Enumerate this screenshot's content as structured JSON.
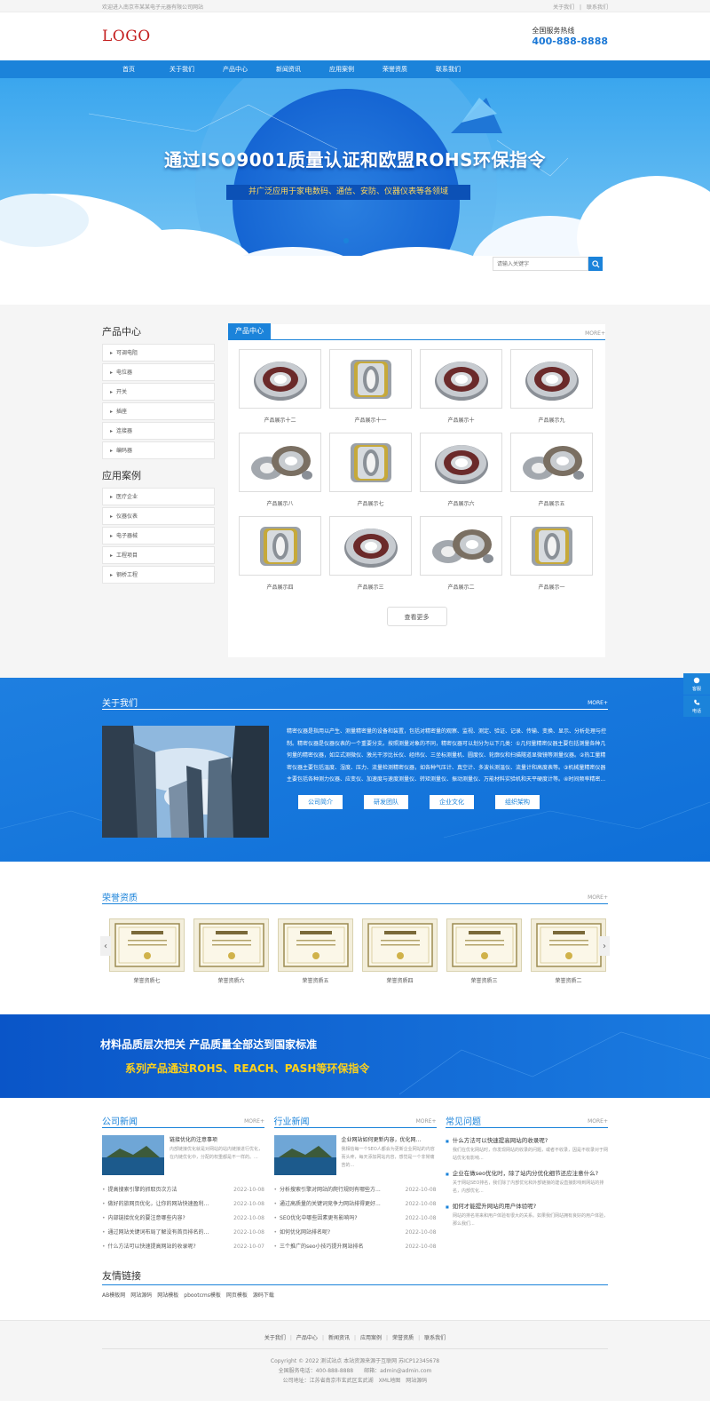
{
  "topbar": {
    "welcome": "欢迎进入南京市某某电子元器有限公司网站",
    "links": [
      "关于我们",
      "联系我们"
    ],
    "sep": "|"
  },
  "header": {
    "logo": "LOGO",
    "hotline_label": "全国服务热线",
    "hotline": "400-888-8888"
  },
  "nav": [
    "首页",
    "关于我们",
    "产品中心",
    "新闻资讯",
    "应用案例",
    "荣誉资质",
    "联系我们"
  ],
  "banner": {
    "title": "通过ISO9001质量认证和欧盟ROHS环保指令",
    "subtitle": "并广泛应用于家电数码、通信、安防、仪器仪表等各领域"
  },
  "search": {
    "placeholder": "请输入关键字"
  },
  "sidebar": {
    "products_title": "产品中心",
    "products": [
      "可调电阻",
      "电位器",
      "开关",
      "插座",
      "连接器",
      "编码器"
    ],
    "cases_title": "应用案例",
    "cases": [
      "医疗企业",
      "仪器仪表",
      "电子器械",
      "工程项目",
      "钢桥工程"
    ]
  },
  "products": {
    "tab": "产品中心",
    "more": "MORE+",
    "items": [
      "产品展示十二",
      "产品展示十一",
      "产品展示十",
      "产品展示九",
      "产品展示八",
      "产品展示七",
      "产品展示六",
      "产品展示五",
      "产品展示四",
      "产品展示三",
      "产品展示二",
      "产品展示一"
    ],
    "view_more": "查看更多"
  },
  "about": {
    "title": "关于我们",
    "more": "MORE+",
    "text": "精密仪器是指用以产生、测量精密量的设备和装置，包括对精密量的观察、监视、测定、验证、记录、传输、变换、显示、分析处理与控制。精密仪器是仪器仪表的一个重要分支。按照测量对象的不同，精密仪器可以划分为以下几类：①几何量精密仪器主要包括测量各种几何量的精密仪器，如立式测微仪、激光干涉比长仪、经纬仪、三坐标测量机、圆度仪、轮廓仪和扫描隧道显微镜等测量仪器。②热工量精密仪器主要包括温度、湿度、压力、流量检测精密仪器，如各种气压计、真空计、多波长测温仪、流量计和高度表等。③机械量精密仪器主要包括各种测力仪器、应变仪、加速度与速度测量仪、转矩测量仪、振动测量仪、万能材料实验机和天平硬度计等。④时间频率精密...",
    "buttons": [
      "公司简介",
      "研发团队",
      "企业文化",
      "组织架构"
    ]
  },
  "float_bar": [
    "客服",
    "电话"
  ],
  "honor": {
    "title": "荣誉资质",
    "more": "MORE+",
    "items": [
      "荣誉资质七",
      "荣誉资质六",
      "荣誉资质五",
      "荣誉资质四",
      "荣誉资质三",
      "荣誉资质二"
    ]
  },
  "quality": {
    "line1": "材料品质层次把关 产品质量全部达到国家标准",
    "line2": "系列产品通过ROHS、REACH、PASH等环保指令"
  },
  "news": {
    "company": {
      "title": "公司新闻",
      "more": "MORE+",
      "feature_title": "链接优化的注意事项",
      "feature_desc": "内部链接优化就是对网站的站内链接进行优化，在内链优化中，分配的权重都是不一样的。...",
      "list": [
        {
          "t": "提高搜索引擎的抓取页次方法",
          "d": "2022-10-08"
        },
        {
          "t": "做好的旅网页优化，让你的网站快速盈利...",
          "d": "2022-10-08"
        },
        {
          "t": "内部链接优化的要注意哪些内容?",
          "d": "2022-10-08"
        },
        {
          "t": "通过网站关键词布局了解没有首页排名的...",
          "d": "2022-10-08"
        },
        {
          "t": "什么方法可以快速提高网站的收录呢?",
          "d": "2022-10-07"
        }
      ]
    },
    "industry": {
      "title": "行业新闻",
      "more": "MORE+",
      "feature_title": "企业网站如何更新内容，优化网...",
      "feature_desc": "我相信每一个SEO人都会为更新企业网站的内容而头疼，每天添加网站内容，感觉是一个非常痛苦的...",
      "list": [
        {
          "t": "分析搜索引擎对网站的爬行规则有哪些方...",
          "d": "2022-10-08"
        },
        {
          "t": "通过高质量的关键词竞争力网站排得更好...",
          "d": "2022-10-08"
        },
        {
          "t": "SEO优化中哪些因素更有影响吗?",
          "d": "2022-10-08"
        },
        {
          "t": "如何优化网站排名呢?",
          "d": "2022-10-08"
        },
        {
          "t": "三个推广的seo小技巧提升网站排名",
          "d": "2022-10-08"
        }
      ]
    },
    "faq": {
      "title": "常见问题",
      "more": "MORE+",
      "items": [
        {
          "q": "什么方法可以快速提高网站的收录呢?",
          "a": "我们在优化网站时，你发现网站的收录的问题，或者不收录，因是不收录对于网站优化有影响..."
        },
        {
          "q": "企业在做seo优化时，除了站内分优化细节还应注意什么?",
          "a": "关于网站SEO排名，我们除了内部优化和外部链接的建设直接影响到网站的排名，内部优化..."
        },
        {
          "q": "如何才能提升网站的用户体验呢?",
          "a": "网站的排名将来和用户体验有很大的关系。如果我们网站拥有良好的用户体验，那么我们..."
        }
      ]
    }
  },
  "links": {
    "title": "友情链接",
    "items": [
      "AB模板网",
      "网站源码",
      "网站模板",
      "pbootcms模板",
      "网页模板",
      "源码下载"
    ]
  },
  "footer": {
    "nav": [
      "关于我们",
      "产品中心",
      "新闻资讯",
      "应用案例",
      "荣誉资质",
      "联系我们"
    ],
    "copyright": "Copyright © 2022 测试站点 本站资源来源于互联网 苏ICP12345678",
    "phone": "全国服务电话：400-888-8888　　邮箱：admin@admin.com",
    "address": "公司地址：江苏省南京市玄武区玄武湖　XML地图　网站源码"
  },
  "colors": {
    "primary": "#1b83da",
    "logo": "#c41e1e",
    "accent_yellow": "#ffd21a"
  }
}
